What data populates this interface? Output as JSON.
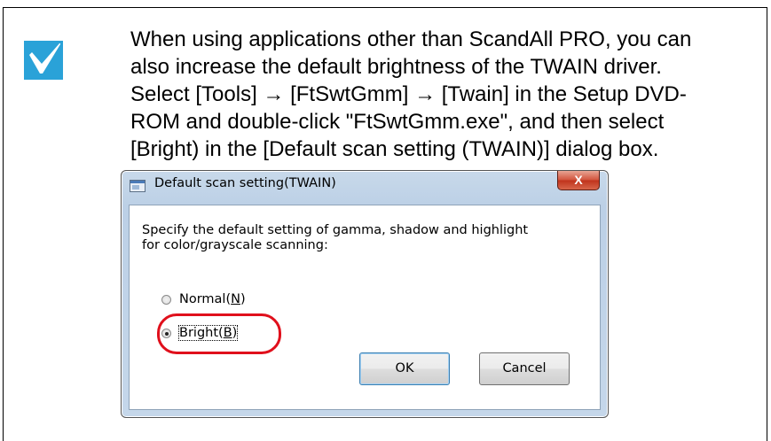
{
  "note": {
    "lines": [
      "When using applications other than ScandAll PRO, you can",
      "also increase the default brightness of the TWAIN driver.",
      "Select [Tools] → [FtSwtGmm] → [Twain] in the Setup DVD-",
      "ROM and double-click \"FtSwtGmm.exe\", and then select",
      "[Bright) in the [Default scan setting (TWAIN)] dialog box."
    ],
    "icon": "checkmark-icon",
    "accent_color": "#2aa2d8"
  },
  "dialog": {
    "title": "Default scan setting(TWAIN)",
    "close_label": "X",
    "description_lines": [
      "Specify the default setting of gamma, shadow and highlight",
      "for color/grayscale scanning:"
    ],
    "options": [
      {
        "label_pre": "Normal(",
        "accel": "N",
        "label_post": ")",
        "selected": false
      },
      {
        "label_pre": "Bright(",
        "accel": "B",
        "label_post": ")",
        "selected": true
      }
    ],
    "ok_label": "OK",
    "cancel_label": "Cancel",
    "highlight_color": "#e0101c"
  }
}
